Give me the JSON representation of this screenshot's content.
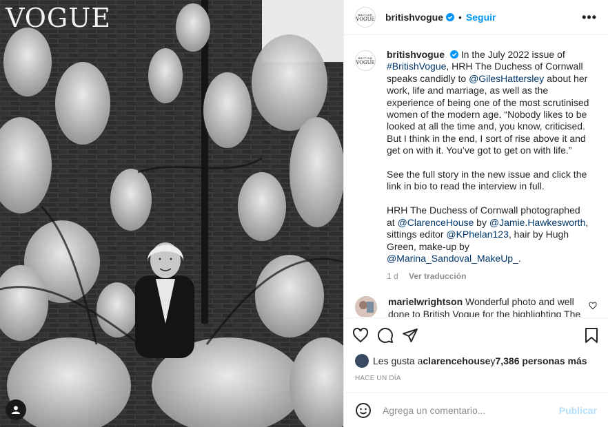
{
  "photo": {
    "masthead": "VOGUE",
    "avatar_text_top": "BRITISH",
    "avatar_text_bottom": "VOGUE"
  },
  "header": {
    "username": "britishvogue",
    "separator": "•",
    "follow_label": "Seguir",
    "more_label": "•••"
  },
  "caption": {
    "username": "britishvogue",
    "intro": "In the July 2022 issue of",
    "hashtag": "#BritishVogue",
    "p1a": ", HRH The Duchess of Cornwall speaks candidly to ",
    "mention1": "@GilesHattersley",
    "p1b": " about her work, life and marriage, as well as the experience of being one of the most scrutinised women of the modern age. “Nobody likes to be looked at all the time and, you know, criticised. But I think in the end, I sort of rise above it and get on with it. You’ve got to get on with life.”",
    "p2": "See the full story in the new issue and click the link in bio to read the interview in full.",
    "p3a": "HRH The Duchess of Cornwall photographed at ",
    "mention2": "@ClarenceHouse",
    "p3b": " by ",
    "mention3": "@Jamie.Hawkesworth",
    "p3c": ", sittings editor ",
    "mention4": "@KPhelan123",
    "p3d": ", hair by Hugh Green, make-up by ",
    "mention5": "@Marina_Sandoval_MakeUp_",
    "p3e": ".",
    "age": "1 d",
    "translate": "Ver traducción"
  },
  "comment": {
    "username": "marielwrightson",
    "text": "Wonderful photo and well done to British Vogue for the highlighting The Duchess for all the right reasons"
  },
  "likes": {
    "prefix": "Les gusta a ",
    "user": "clarencehouse",
    "middle": " y ",
    "count": "7,386 personas más"
  },
  "timestamp": "HACE UN DÍA",
  "add_comment": {
    "placeholder": "Agrega un comentario...",
    "publish_label": "Publicar"
  },
  "colors": {
    "accent": "#0095f6",
    "link": "#00376b",
    "muted": "#8e8e8e",
    "publish_disabled": "#b2dffc"
  },
  "icons": [
    "verified-badge-icon",
    "more-options-icon",
    "heart-icon",
    "comment-icon",
    "share-icon",
    "save-icon",
    "emoji-icon",
    "user-tag-icon"
  ]
}
